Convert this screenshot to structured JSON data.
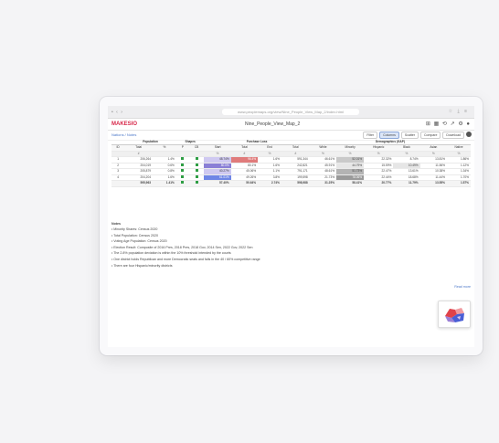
{
  "browser": {
    "tab_dots": "•  ‹  ›",
    "url": "www.peoplemaps.org/view/Nine_People_View_Map_2/index.html",
    "icons": "☆ ⤓ ≡"
  },
  "app": {
    "logo": "MAKESIO",
    "document_title": "Nine_People_View_Map_2",
    "header_icons": "⊞ ▦ ⟲ ↗ ⚙ ●"
  },
  "toolbar": {
    "breadcrumb": "Nations  /  Notes",
    "buttons": [
      "Filter",
      "Columns",
      "Scatter",
      "Compare",
      "Download"
    ]
  },
  "table": {
    "group_headers": [
      "",
      "Population",
      "",
      "Shapes",
      "",
      "Purchase Loss",
      "",
      "",
      "",
      "",
      "Demographics (GAP)",
      "",
      "",
      "",
      ""
    ],
    "sub_headers": [
      "ID",
      "Total",
      "%",
      "P",
      "CB",
      "Start",
      "Total",
      "End",
      "Total",
      "White",
      "Minority",
      "Hispanic",
      "Black",
      "Asian",
      "Native"
    ],
    "unit_row": [
      "",
      "#",
      "",
      "",
      "",
      "%",
      "#",
      "%",
      "#",
      "%",
      "%",
      "%",
      "%",
      "%",
      "%"
    ],
    "rows": [
      [
        "1",
        "206,264",
        "1.4%",
        "■",
        "■",
        "48.74%",
        "96.4%",
        "1.6%",
        "591,344",
        "46.61%",
        "52.01%",
        "22.32%",
        "8.74%",
        "13.81%",
        "1.86%"
      ],
      [
        "2",
        "204,019",
        "0.6%",
        "■",
        "■",
        "80.0%",
        "80.1%",
        "1.6%",
        "242,821",
        "45.91%",
        "44.79%",
        "15.59%",
        "10.49%",
        "11.56%",
        "1.12%"
      ],
      [
        "3",
        "205,879",
        "0.8%",
        "■",
        "■",
        "40.27%",
        "45.06%",
        "1.1%",
        "791,171",
        "48.61%",
        "51.73%",
        "22.47%",
        "13.61%",
        "10.38%",
        "1.34%"
      ],
      [
        "4",
        "204,204",
        "1.6%",
        "■",
        "■",
        "61.01%",
        "49.26%",
        "3.8%",
        "199,598",
        "21.73%",
        "78.06%",
        "22.44%",
        "18.68%",
        "11.44%",
        "1.70%"
      ]
    ],
    "total_row": [
      "",
      "595,963",
      "1.41%",
      "■",
      "■",
      "57.40%",
      "50.64%",
      "2.74%",
      "598,988",
      "31.25%",
      "58.41%",
      "20.77%",
      "11.79%",
      "13.55%",
      "1.57%"
    ]
  },
  "notes": {
    "title": "Notes",
    "items": [
      "• Minority Shares: Census 2020",
      "• Total Population: Census 2020",
      "• Voting Age Population: Census 2020",
      "• Election Result: Composite of 2016 Pres, 2018 Pres, 2018 Gov, 2014 Sen, 2022 Gov, 2022 Sen",
      "• The 2.8% population deviation is within the 10% threshold intended by the courts",
      "• One district holds Republican and more Democratic seats and falls in the 40 / 60% competitive range",
      "• There are four Hispanic/minority districts"
    ],
    "read_more": "Read more"
  },
  "colors": {
    "brand": "#d7284a",
    "link": "#4a76c8",
    "shape_ok": "#2e9e44"
  }
}
